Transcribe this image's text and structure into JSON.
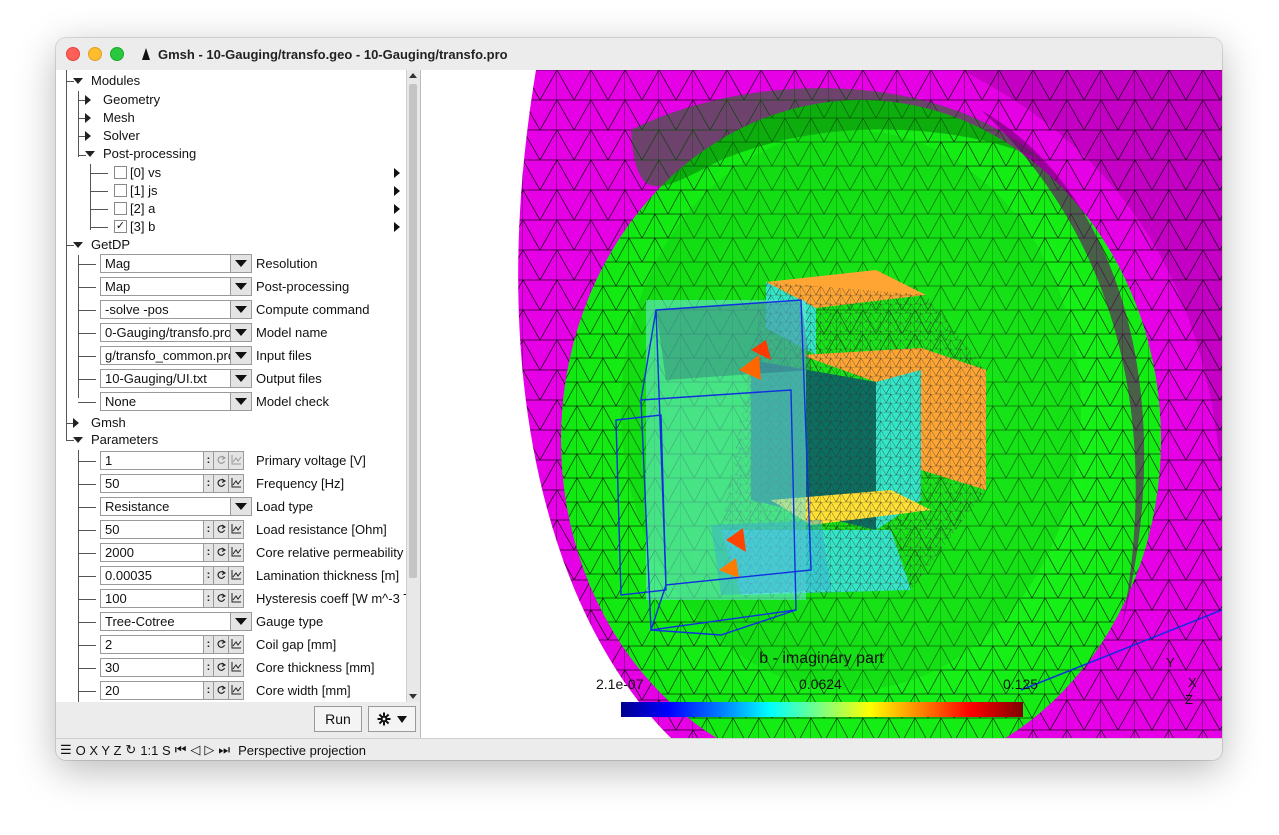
{
  "window": {
    "title": "Gmsh - 10-Gauging/transfo.geo - 10-Gauging/transfo.pro"
  },
  "tree": {
    "modules": "Modules",
    "geometry": "Geometry",
    "mesh": "Mesh",
    "solver": "Solver",
    "postprocessing": "Post-processing",
    "views": [
      {
        "label": "[0] vs",
        "checked": false
      },
      {
        "label": "[1] js",
        "checked": false
      },
      {
        "label": "[2] a",
        "checked": false
      },
      {
        "label": "[3] b",
        "checked": true
      }
    ],
    "getdp": "GetDP",
    "gmsh": "Gmsh",
    "parameters": "Parameters"
  },
  "getdp": {
    "resolution": {
      "value": "Mag",
      "label": "Resolution"
    },
    "postpro": {
      "value": "Map",
      "label": "Post-processing"
    },
    "compute": {
      "value": "-solve -pos",
      "label": "Compute command"
    },
    "model": {
      "value": "0-Gauging/transfo.pro",
      "label": "Model name"
    },
    "input": {
      "value": "g/transfo_common.pro",
      "label": "Input files"
    },
    "output": {
      "value": "10-Gauging/UI.txt",
      "label": "Output files"
    },
    "check": {
      "value": "None",
      "label": "Model check"
    }
  },
  "parameters": {
    "primary_voltage": {
      "value": "1",
      "label": "Primary voltage [V]"
    },
    "frequency": {
      "value": "50",
      "label": "Frequency [Hz]"
    },
    "load_type": {
      "value": "Resistance",
      "label": "Load type"
    },
    "load_resistance": {
      "value": "50",
      "label": "Load resistance [Ohm]"
    },
    "core_perm": {
      "value": "2000",
      "label": "Core relative permeability"
    },
    "lamination": {
      "value": "0.00035",
      "label": "Lamination thickness [m]"
    },
    "hysteresis": {
      "value": "100",
      "label": "Hysteresis coeff [W m^-3 T"
    },
    "gauge_type": {
      "value": "Tree-Cotree",
      "label": "Gauge type"
    },
    "coil_gap": {
      "value": "2",
      "label": "Coil gap [mm]"
    },
    "core_thickness": {
      "value": "30",
      "label": "Core thickness [mm]"
    },
    "core_width": {
      "value": "20",
      "label": "Core width [mm]"
    }
  },
  "buttons": {
    "run": "Run"
  },
  "statusbar": {
    "tools": "O X Y Z",
    "scale": "1:1 S",
    "projection": "Perspective projection"
  },
  "colorbar": {
    "title": "b - imaginary part",
    "min": "2.1e-07",
    "mid": "0.0624",
    "max": "0.125"
  },
  "axes": {
    "y": "Y",
    "x": "X",
    "z": "Z"
  },
  "colors": {
    "outer_shell": "#e600e6",
    "sphere": "#19ff19",
    "core_orange": "#ffa533",
    "core_cyan": "#33e6c8",
    "frame_blue": "#1030e0"
  }
}
